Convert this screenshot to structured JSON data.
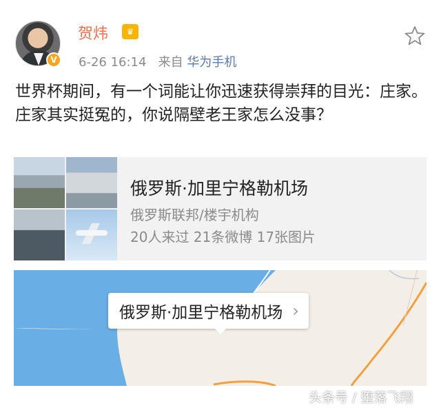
{
  "header": {
    "username": "贺炜",
    "verified_badge": "V",
    "member_icon": "crown-icon",
    "time": "6-26 16:14",
    "source_prefix": "来自",
    "source": "华为手机"
  },
  "post": {
    "text": "世界杯期间，有一个词能让你迅速获得崇拜的目光：庄家。庄家其实挺冤的，你说隔壁老王家怎么没事？"
  },
  "place_card": {
    "title": "俄罗斯·加里宁格勒机场",
    "subtitle": "俄罗斯联邦/楼宇机构",
    "stats": "20人来过 21条微博 17张图片"
  },
  "map": {
    "label": "俄罗斯·加里宁格勒机场",
    "chevron": "›"
  },
  "watermark": "头条号 / 堕落飞翔",
  "colors": {
    "username": "#eb7350",
    "source": "#5b7aa9",
    "water": "#6aaee6",
    "road": "#f0a040"
  }
}
